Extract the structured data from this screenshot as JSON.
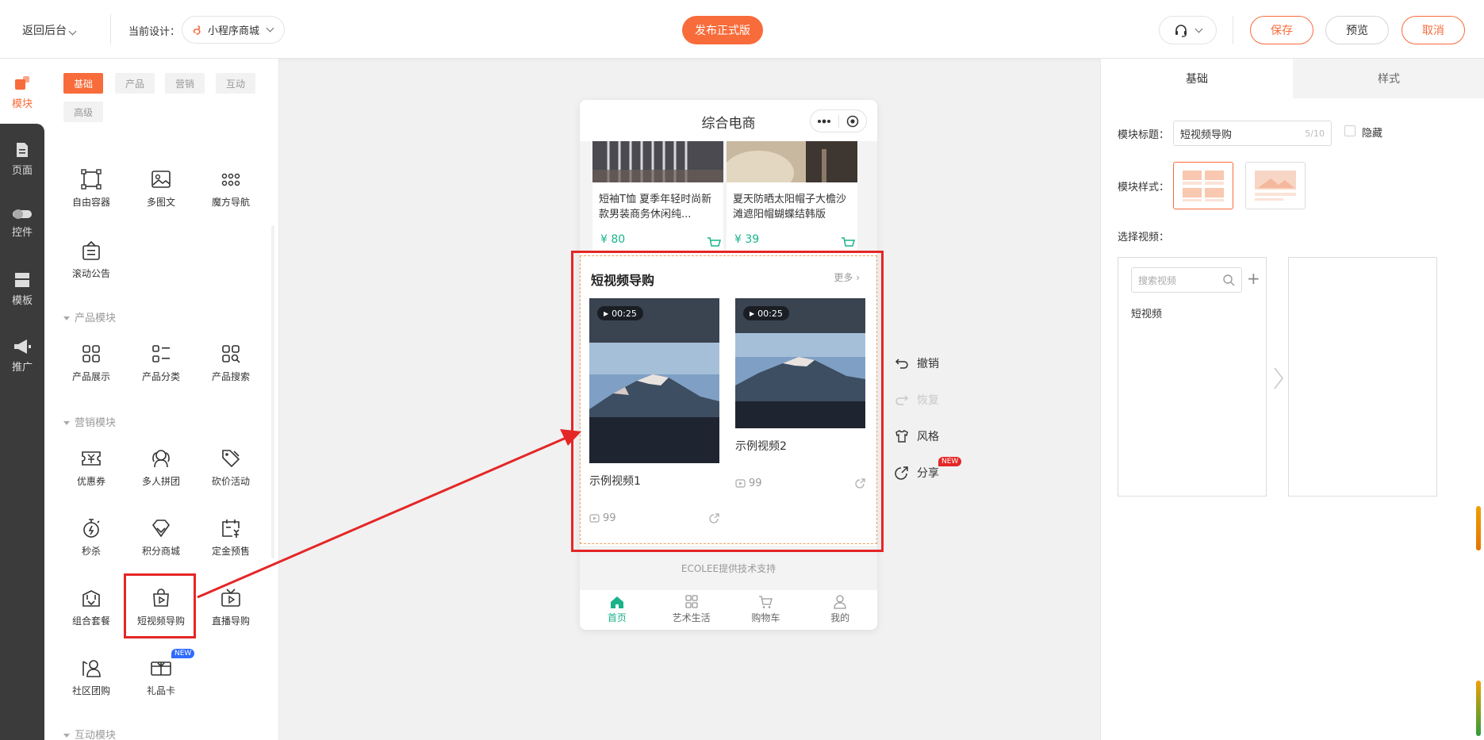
{
  "topbar": {
    "back_label": "返回后台",
    "design_label": "当前设计：",
    "design_value": "小程序商城",
    "publish_label": "发布正式版",
    "save_label": "保存",
    "preview_label": "预览",
    "cancel_label": "取消"
  },
  "rail": {
    "items": [
      {
        "label": "模块",
        "icon": "modules-icon"
      },
      {
        "label": "页面",
        "icon": "page-icon"
      },
      {
        "label": "控件",
        "icon": "toggle-icon"
      },
      {
        "label": "模板",
        "icon": "template-icon"
      },
      {
        "label": "推广",
        "icon": "megaphone-icon"
      }
    ]
  },
  "modules": {
    "tabs": [
      "基础",
      "产品",
      "营销",
      "互动",
      "高级"
    ],
    "basic": [
      "自由容器",
      "多图文",
      "魔方导航",
      "滚动公告"
    ],
    "product_section": "产品模块",
    "product": [
      "产品展示",
      "产品分类",
      "产品搜索"
    ],
    "marketing_section": "营销模块",
    "marketing": [
      "优惠券",
      "多人拼团",
      "砍价活动",
      "秒杀",
      "积分商城",
      "定金预售",
      "组合套餐",
      "短视频导购",
      "直播导购",
      "社区团购",
      "礼品卡"
    ],
    "new_badge": "NEW",
    "interactive_section": "互动模块"
  },
  "phone": {
    "title": "综合电商",
    "products": [
      {
        "name": "短袖T恤 夏季年轻时尚新款男装商务休闲纯...",
        "price": "¥ 80"
      },
      {
        "name": "夏天防晒太阳帽子大檐沙滩遮阳帽蝴蝶结韩版",
        "price": "¥ 39"
      }
    ],
    "video_module": {
      "title": "短视频导购",
      "more": "更多",
      "videos": [
        {
          "duration": "00:25",
          "name": "示例视频1",
          "views": "99"
        },
        {
          "duration": "00:25",
          "name": "示例视频2",
          "views": "99"
        }
      ]
    },
    "powered_by": "ECOLEE提供技术支持",
    "tabbar": [
      "首页",
      "艺术生活",
      "购物车",
      "我的"
    ]
  },
  "side_actions": {
    "undo": "撤销",
    "redo": "恢复",
    "style": "风格",
    "share": "分享",
    "share_badge": "NEW"
  },
  "right_panel": {
    "tabs": [
      "基础",
      "样式"
    ],
    "title_label": "模块标题：",
    "title_value": "短视频导购",
    "title_count": "5/10",
    "hide_label": "隐藏",
    "style_label": "模块样式：",
    "select_video_label": "选择视频：",
    "search_placeholder": "搜索视频",
    "category": "短视频"
  },
  "colors": {
    "accent": "#f86b3a",
    "highlight": "#e52626",
    "price": "#19b38a"
  }
}
